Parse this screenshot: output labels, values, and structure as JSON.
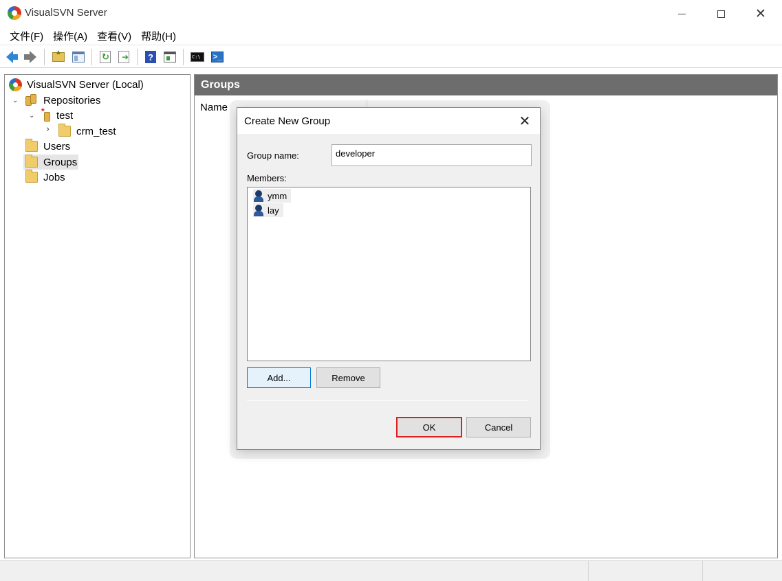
{
  "window": {
    "title": "VisualSVN Server",
    "icon": "visualsvn-logo-icon",
    "controls": [
      "minimize-icon",
      "maximize-icon",
      "close-icon"
    ]
  },
  "menu": {
    "items": [
      "文件(F)",
      "操作(A)",
      "查看(V)",
      "帮助(H)"
    ]
  },
  "toolbar": {
    "icons": [
      "back-arrow-icon",
      "forward-arrow-icon",
      "up-folder-icon",
      "show-hide-tree-icon",
      "refresh-icon",
      "export-list-icon",
      "help-icon",
      "properties-icon",
      "command-prompt-icon",
      "powershell-icon"
    ],
    "cmd_text": "C:\\",
    "help_text": "?",
    "ps_text": ">_"
  },
  "tree": {
    "root": "VisualSVN Server (Local)",
    "repositories": "Repositories",
    "repo": "test",
    "repo_modified_mark": "*",
    "subfolder": "crm_test",
    "users": "Users",
    "groups": "Groups",
    "jobs": "Jobs",
    "selected": "Groups"
  },
  "main": {
    "header": "Groups",
    "columns": [
      "Name"
    ]
  },
  "dialog": {
    "title": "Create New Group",
    "group_name_label": "Group name:",
    "group_name_value": "developer",
    "members_label": "Members:",
    "members": [
      "ymm",
      "lay"
    ],
    "add_label": "Add...",
    "remove_label": "Remove",
    "ok_label": "OK",
    "cancel_label": "Cancel",
    "ok_highlight_color": "#e0201e"
  }
}
